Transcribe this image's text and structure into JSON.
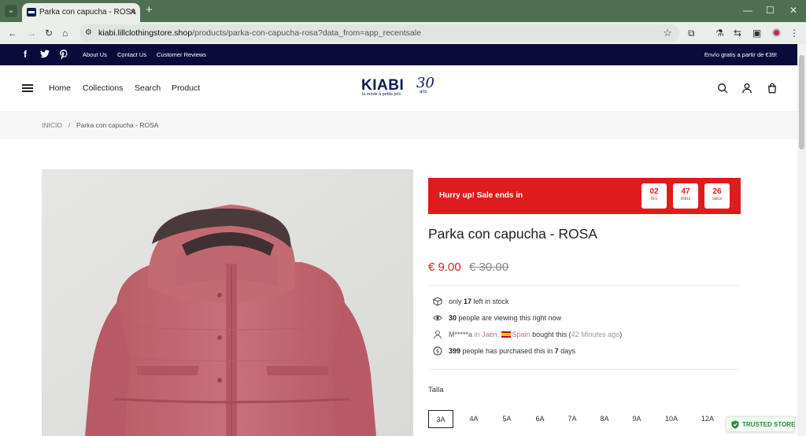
{
  "browser": {
    "tab_title": "Parka con capucha - ROSA",
    "url_host": "kiabi.lillclothingstore.shop",
    "url_path": "/products/parka-con-capucha-rosa?data_from=app_recentsale"
  },
  "announcement": {
    "links": [
      "About Us",
      "Contact Us",
      "Customer Reviews"
    ],
    "shipping_note": "Envío gratis a partir de €39!"
  },
  "header": {
    "nav": [
      "Home",
      "Collections",
      "Search",
      "Product"
    ],
    "logo_main": "KIABI",
    "logo_number": "30",
    "logo_tagline": "la mode à petits prix",
    "logo_ans": "ans"
  },
  "breadcrumb": {
    "home": "INICIO",
    "separator": "/",
    "current": "Parka con capucha - ROSA"
  },
  "product": {
    "hurry_text": "Hurry up!  Sale ends in",
    "countdown": [
      {
        "value": "02",
        "unit": "hrs"
      },
      {
        "value": "47",
        "unit": "mins"
      },
      {
        "value": "26",
        "unit": "secs"
      }
    ],
    "title": "Parka con capucha - ROSA",
    "price_now": "€ 9.00",
    "price_was": "€ 30.00",
    "stock": {
      "pre": "only ",
      "count": "17",
      "post": " left in stock"
    },
    "viewing": {
      "count": "30",
      "post": " people are viewing this right now"
    },
    "recent": {
      "buyer": "M*****a",
      "in": " in ",
      "city": "Jaén",
      "country": "Spain",
      "action": " bought this (",
      "time": "42 Minutes ago",
      "close": ")"
    },
    "purchased": {
      "count": "399",
      "mid": " people has purchased this in ",
      "days": "7",
      "post": " days"
    },
    "size_label": "Talla",
    "sizes": [
      "3A",
      "4A",
      "5A",
      "6A",
      "7A",
      "8A",
      "9A",
      "10A",
      "12A"
    ],
    "selected_size": "3A"
  },
  "trust_badge": "TRUSTED STORE",
  "colors": {
    "announce_bg": "#0b0b3b",
    "sale_red": "#e01b1b",
    "jacket_pink": "#c46a72",
    "chrome_green": "#4f6f52"
  }
}
